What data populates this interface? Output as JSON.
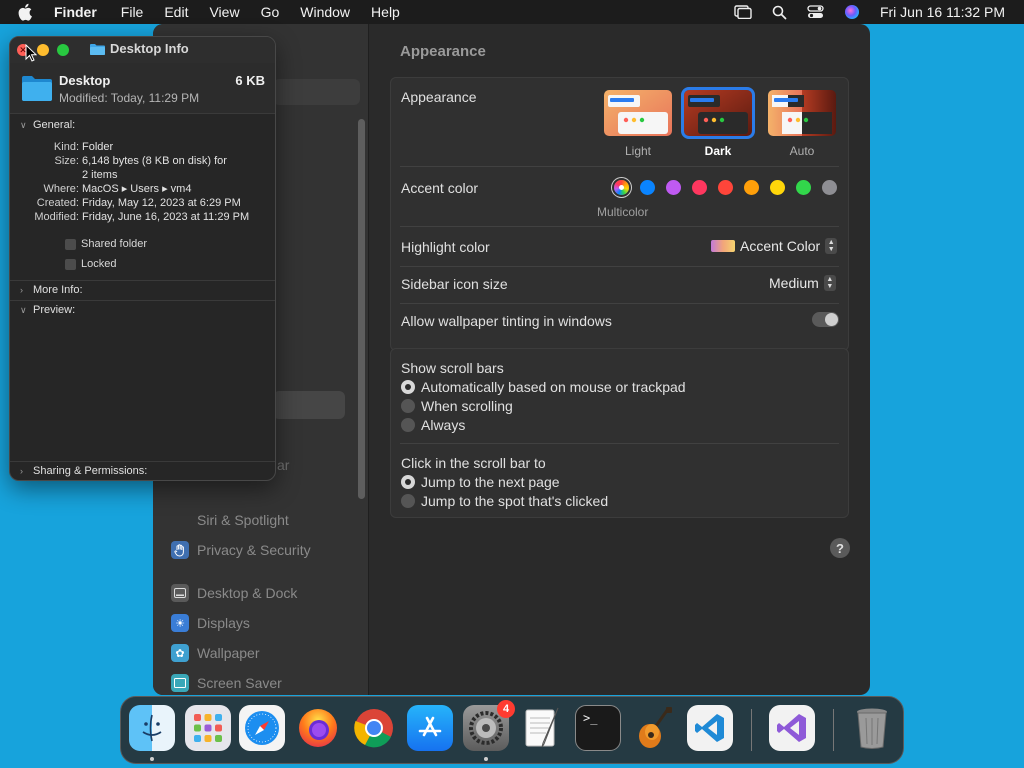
{
  "menubar": {
    "app_name": "Finder",
    "items": [
      "File",
      "Edit",
      "View",
      "Go",
      "Window",
      "Help"
    ],
    "clock": "Fri Jun 16  11:32 PM"
  },
  "settings": {
    "content_title": "Appearance",
    "sidebar": {
      "partial_item": "ar",
      "items": [
        {
          "label": "Siri & Spotlight",
          "icon": "siri-icon"
        },
        {
          "label": "Privacy & Security",
          "icon": "hand-icon"
        },
        {
          "label": "Desktop & Dock",
          "icon": "dock-icon"
        },
        {
          "label": "Displays",
          "icon": "sun-icon"
        },
        {
          "label": "Wallpaper",
          "icon": "flower-icon"
        },
        {
          "label": "Screen Saver",
          "icon": "screensaver-icon"
        }
      ]
    },
    "appearance": {
      "label": "Appearance",
      "options": [
        {
          "label": "Light",
          "selected": false
        },
        {
          "label": "Dark",
          "selected": true
        },
        {
          "label": "Auto",
          "selected": false
        }
      ]
    },
    "accent": {
      "label": "Accent color",
      "selected_label": "Multicolor",
      "colors": [
        "multicolor",
        "#0a84ff",
        "#bf5af2",
        "#ff375f",
        "#ff453a",
        "#ff9f0a",
        "#ffd60a",
        "#32d74b",
        "#8e8e93"
      ]
    },
    "highlight": {
      "label": "Highlight color",
      "value": "Accent Color"
    },
    "sidebar_icon_size": {
      "label": "Sidebar icon size",
      "value": "Medium"
    },
    "wallpaper_tinting": {
      "label": "Allow wallpaper tinting in windows",
      "enabled": false
    },
    "scroll_bars": {
      "label": "Show scroll bars",
      "options": [
        {
          "label": "Automatically based on mouse or trackpad",
          "selected": true
        },
        {
          "label": "When scrolling",
          "selected": false
        },
        {
          "label": "Always",
          "selected": false
        }
      ]
    },
    "click_scroll": {
      "label": "Click in the scroll bar to",
      "options": [
        {
          "label": "Jump to the next page",
          "selected": true
        },
        {
          "label": "Jump to the spot that's clicked",
          "selected": false
        }
      ]
    },
    "help": "?"
  },
  "info_window": {
    "title": "Desktop Info",
    "name": "Desktop",
    "size": "6 KB",
    "modified_line": "Modified: Today, 11:29 PM",
    "general": {
      "header": "General:",
      "rows": [
        {
          "key": "Kind:",
          "value": "Folder"
        },
        {
          "key": "Size:",
          "value": "6,148 bytes (8 KB on disk) for"
        },
        {
          "key": "",
          "value": "2 items"
        },
        {
          "key": "Where:",
          "value": "MacOS ▸ Users ▸ vm4"
        },
        {
          "key": "Created:",
          "value": "Friday, May 12, 2023 at 6:29 PM"
        },
        {
          "key": "Modified:",
          "value": "Friday, June 16, 2023 at 11:29 PM"
        }
      ],
      "checkboxes": [
        {
          "label": "Shared folder",
          "checked": false
        },
        {
          "label": "Locked",
          "checked": false
        }
      ]
    },
    "more_info": "More Info:",
    "preview": "Preview:",
    "sharing": "Sharing & Permissions:"
  },
  "dock": {
    "apps": [
      {
        "name": "Finder",
        "icon": "finder-icon",
        "running": true
      },
      {
        "name": "Launchpad",
        "icon": "launchpad-icon",
        "running": false
      },
      {
        "name": "Safari",
        "icon": "safari-icon",
        "running": false
      },
      {
        "name": "Firefox",
        "icon": "firefox-icon",
        "running": false
      },
      {
        "name": "Chrome",
        "icon": "chrome-icon",
        "running": false
      },
      {
        "name": "App Store",
        "icon": "appstore-icon",
        "running": false
      },
      {
        "name": "System Settings",
        "icon": "settings-gear-icon",
        "running": true,
        "badge": "4"
      },
      {
        "name": "TextEdit",
        "icon": "textedit-icon",
        "running": false
      },
      {
        "name": "Terminal",
        "icon": "terminal-icon",
        "running": false
      },
      {
        "name": "GarageBand",
        "icon": "guitar-icon",
        "running": false
      },
      {
        "name": "Visual Studio Code",
        "icon": "vscode-icon",
        "running": false
      },
      {
        "name": "Visual Studio",
        "icon": "visualstudio-icon",
        "running": false
      },
      {
        "name": "Trash",
        "icon": "trash-icon",
        "running": false
      }
    ],
    "terminal_prompt": ">_"
  }
}
